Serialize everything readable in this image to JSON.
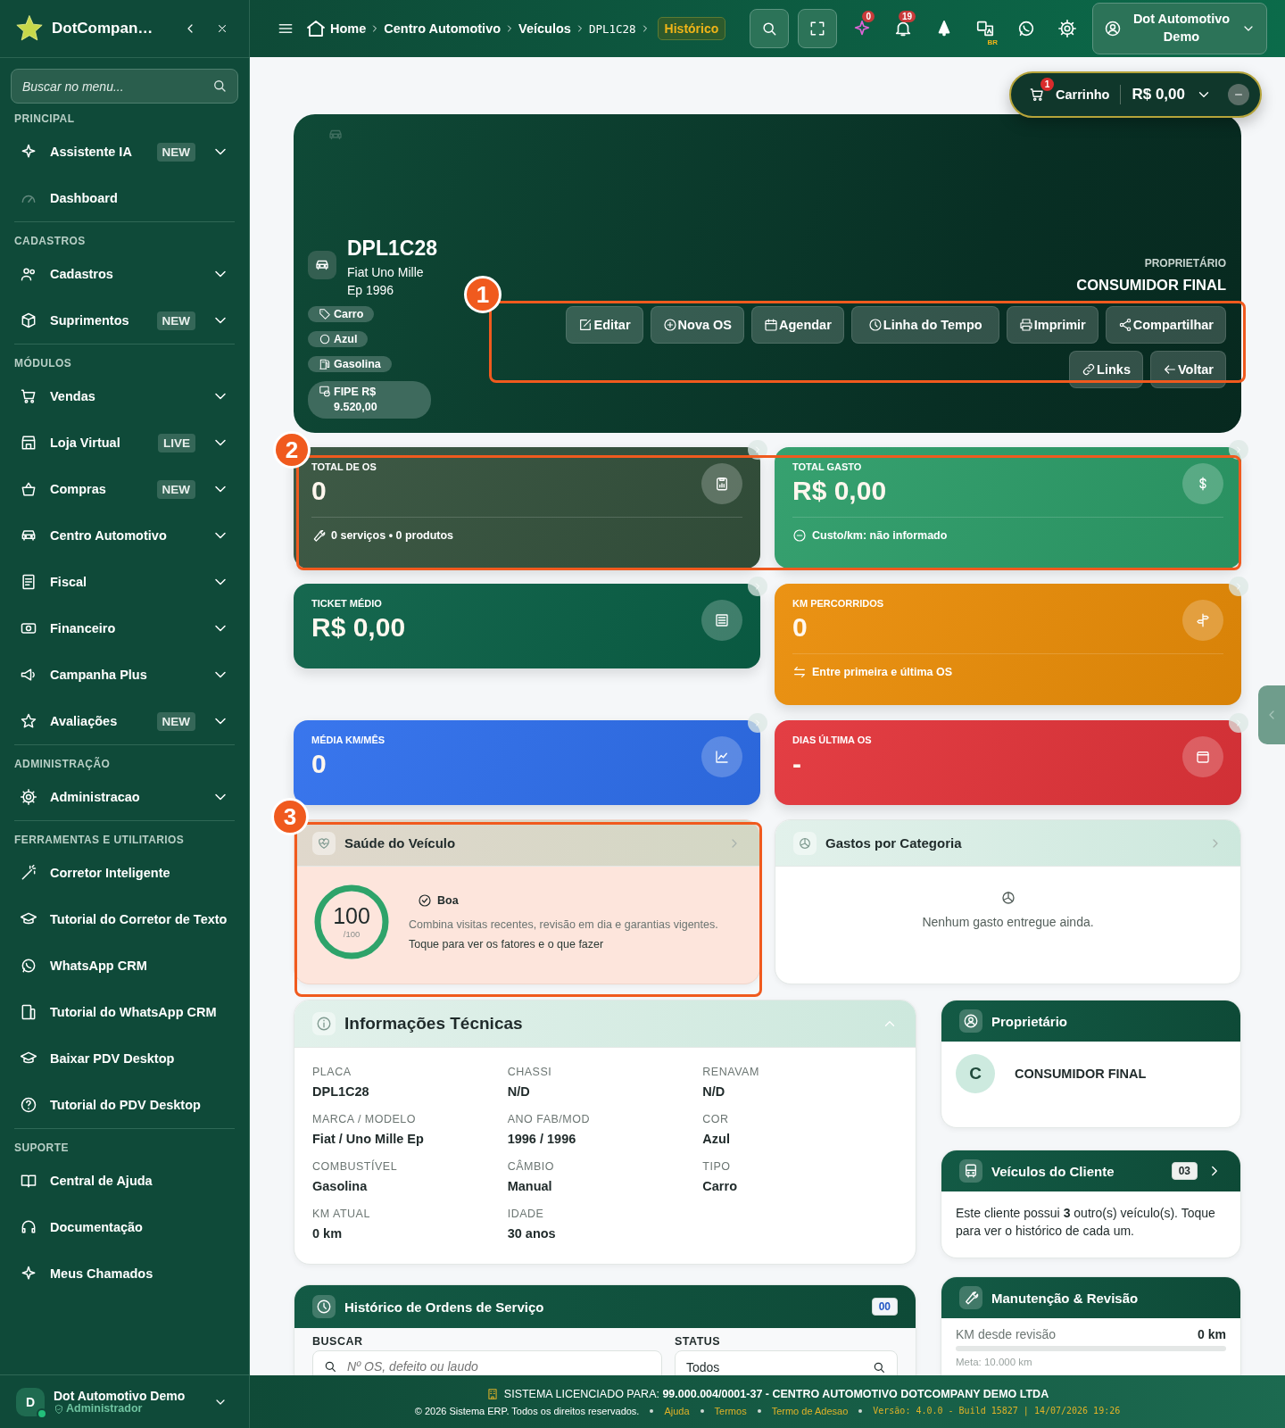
{
  "sidebar": {
    "brand": "DotCompan…",
    "search": {
      "placeholder": "Buscar no menu..."
    },
    "sections": [
      {
        "title": "PRINCIPAL",
        "items": [
          {
            "label": "Assistente IA",
            "badge": "NEW",
            "expandable": true
          },
          {
            "label": "Dashboard",
            "expandable": false
          }
        ]
      },
      {
        "title": "CADASTROS",
        "items": [
          {
            "label": "Cadastros",
            "expandable": true
          },
          {
            "label": "Suprimentos",
            "badge": "NEW",
            "expandable": true
          }
        ]
      },
      {
        "title": "MÓDULOS",
        "items": [
          {
            "label": "Vendas",
            "expandable": true
          },
          {
            "label": "Loja Virtual",
            "badge": "LIVE",
            "expandable": true
          },
          {
            "label": "Compras",
            "badge": "NEW",
            "expandable": true
          },
          {
            "label": "Centro Automotivo",
            "expandable": true
          },
          {
            "label": "Fiscal",
            "expandable": true
          },
          {
            "label": "Financeiro",
            "expandable": true
          },
          {
            "label": "Campanha Plus",
            "expandable": true
          },
          {
            "label": "Avaliações",
            "badge": "NEW",
            "expandable": true
          }
        ]
      },
      {
        "title": "ADMINISTRAÇÃO",
        "items": [
          {
            "label": "Administracao",
            "expandable": true
          }
        ]
      },
      {
        "title": "FERRAMENTAS E UTILITARIOS",
        "items": [
          {
            "label": "Corretor Inteligente",
            "expandable": false
          },
          {
            "label": "Tutorial do Corretor de Texto",
            "expandable": false
          },
          {
            "label": "WhatsApp CRM",
            "expandable": false
          },
          {
            "label": "Tutorial do WhatsApp CRM",
            "expandable": false
          },
          {
            "label": "Baixar PDV Desktop",
            "expandable": false
          },
          {
            "label": "Tutorial do PDV Desktop",
            "expandable": false
          }
        ]
      },
      {
        "title": "SUPORTE",
        "items": [
          {
            "label": "Central de Ajuda",
            "expandable": false
          },
          {
            "label": "Documentação",
            "expandable": false
          },
          {
            "label": "Meus Chamados",
            "expandable": false
          }
        ]
      }
    ],
    "user": {
      "initial": "D",
      "name": "Dot Automotivo Demo",
      "role": "Administrador",
      "online": true
    }
  },
  "topbar": {
    "breadcrumb": [
      {
        "label": "Home"
      },
      {
        "label": "Centro Automotivo"
      },
      {
        "label": "Veículos"
      },
      {
        "label": "DPL1C28"
      }
    ],
    "current": "Histórico",
    "notifications": [
      "0",
      "19"
    ],
    "language": "BR",
    "user": "Dot Automotivo Demo"
  },
  "cart": {
    "count": "1",
    "label": "Carrinho",
    "total": "R$ 0,00"
  },
  "hero": {
    "plate": "DPL1C28",
    "model": "Fiat Uno Mille Ep 1996",
    "tags": [
      {
        "label": "Carro"
      },
      {
        "label": "Azul"
      },
      {
        "label": "Gasolina"
      },
      {
        "label": "FIPE R$ 9.520,00"
      }
    ],
    "owner_label": "PROPRIETÁRIO",
    "owner": "CONSUMIDOR FINAL",
    "actions": [
      "Editar",
      "Nova OS",
      "Agendar",
      "Linha do Tempo",
      "Imprimir",
      "Compartilhar",
      "Links",
      "Voltar"
    ]
  },
  "stats": [
    {
      "label": "TOTAL DE OS",
      "value": "0",
      "footer": "0 serviços • 0 produtos",
      "color": "#34513c"
    },
    {
      "label": "TOTAL GASTO",
      "value": "R$ 0,00",
      "footer": "Custo/km: não informado",
      "color": "#2c9c68"
    },
    {
      "label": "TICKET MÉDIO",
      "value": "R$ 0,00",
      "color": "#0a6046"
    },
    {
      "label": "KM PERCORRIDOS",
      "value": "0",
      "footer": "Entre primeira e última OS",
      "color": "#ea8d08"
    },
    {
      "label": "MÉDIA KM/MÊS",
      "value": "0",
      "color": "#2f6fec"
    },
    {
      "label": "DIAS ÚLTIMA OS",
      "value": "-",
      "color": "#e2343a"
    }
  ],
  "health": {
    "title": "Saúde do Veículo",
    "score": "100",
    "max": "/100",
    "level": 1,
    "status": "Boa",
    "description": "Combina visitas recentes, revisão em dia e garantias vigentes.",
    "link": "Toque para ver os fatores e o que fazer"
  },
  "spending": {
    "title": "Gastos por Categoria",
    "empty": "Nenhum gasto entregue ainda."
  },
  "tech_info": {
    "title": "Informações Técnicas",
    "expanded": true,
    "fields": [
      {
        "label": "PLACA",
        "value": "DPL1C28"
      },
      {
        "label": "CHASSI",
        "value": "N/D"
      },
      {
        "label": "RENAVAM",
        "value": "N/D"
      },
      {
        "label": "MARCA / MODELO",
        "value": "Fiat / Uno Mille Ep"
      },
      {
        "label": "ANO FAB/MOD",
        "value": "1996 / 1996"
      },
      {
        "label": "COR",
        "value": "Azul"
      },
      {
        "label": "COMBUSTÍVEL",
        "value": "Gasolina"
      },
      {
        "label": "CÂMBIO",
        "value": "Manual"
      },
      {
        "label": "TIPO",
        "value": "Carro"
      },
      {
        "label": "KM ATUAL",
        "value": "0 km"
      },
      {
        "label": "IDADE",
        "value": "30 anos"
      }
    ]
  },
  "owner_card": {
    "title": "Proprietário",
    "initial": "C",
    "name": "CONSUMIDOR FINAL"
  },
  "vehicles_card": {
    "title": "Veículos do Cliente",
    "count": "03",
    "text": "Este cliente possui **3** outro(s) veículo(s). Toque para ver o histórico de cada um."
  },
  "history": {
    "title": "Histórico de Ordens de Serviço",
    "count": "00",
    "search_label": "BUSCAR",
    "search_placeholder": "Nº OS, defeito ou laudo",
    "status_label": "STATUS",
    "status_value": "Todos"
  },
  "maintenance": {
    "title": "Manutenção & Revisão",
    "metric": "KM desde revisão",
    "value": "0 km",
    "level": 0,
    "goal": "Meta: 10.000 km"
  },
  "footer": {
    "license": "SISTEMA LICENCIADO PARA: **99.000.004/0001-37 - CENTRO AUTOMOTIVO DOTCOMPANY DEMO LTDA**",
    "copyright": "© 2026 Sistema ERP. Todos os direitos reservados.",
    "links": [
      "Ajuda",
      "Termos",
      "Termo de Adesao"
    ],
    "version": "Versão: 4.0.0 - Build 15827 | 14/07/2026 19:26"
  },
  "annotations": [
    {
      "number": "1"
    },
    {
      "number": "2"
    },
    {
      "number": "3"
    }
  ]
}
